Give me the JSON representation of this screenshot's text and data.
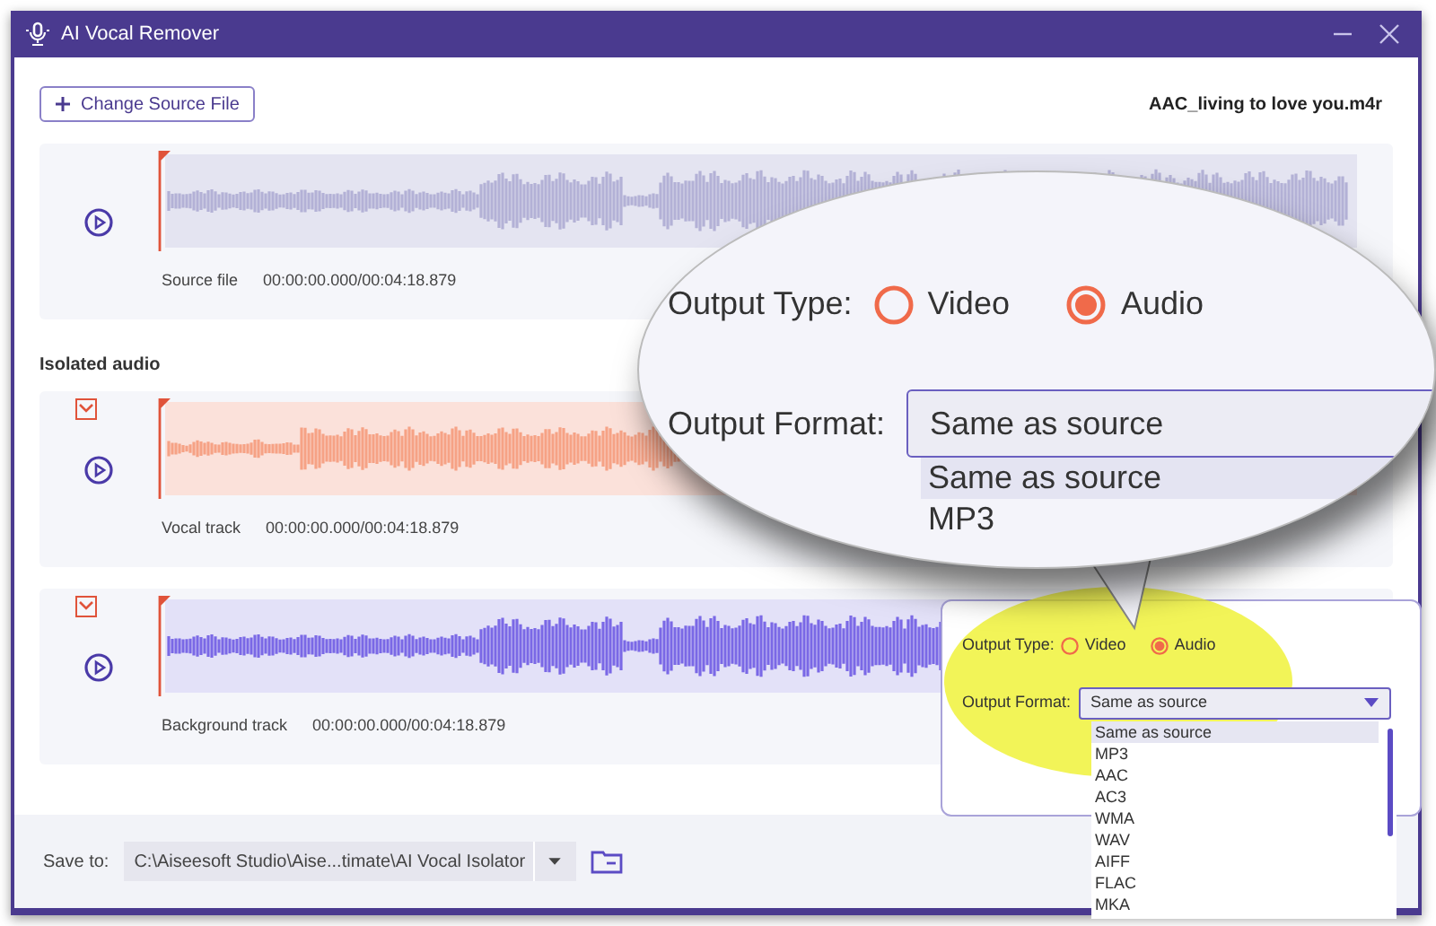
{
  "window": {
    "title": "AI Vocal Remover"
  },
  "change_source_button": {
    "label": "Change Source File"
  },
  "file_name": "AAC_living to love you.m4r",
  "source_track": {
    "kind": "source",
    "label": "Source file",
    "time": "00:00:00.000/00:04:18.879"
  },
  "section_title": "Isolated audio",
  "tracks": [
    {
      "kind": "vocal",
      "checked": true,
      "label": "Vocal track",
      "time": "00:00:00.000/00:04:18.879"
    },
    {
      "kind": "background",
      "checked": true,
      "label": "Background track",
      "time": "00:00:00.000/00:04:18.879"
    }
  ],
  "save_bar": {
    "label": "Save to:",
    "path": "C:\\Aiseesoft Studio\\Aise...timate\\AI Vocal Isolator"
  },
  "output_panel": {
    "type_label": "Output Type:",
    "type_options": [
      {
        "label": "Video",
        "selected": false
      },
      {
        "label": "Audio",
        "selected": true
      }
    ],
    "format_label": "Output Format:",
    "format_value": "Same as source",
    "format_list": [
      {
        "label": "Same as source",
        "selected": true
      },
      {
        "label": "MP3",
        "selected": false
      },
      {
        "label": "AAC",
        "selected": false
      },
      {
        "label": "AC3",
        "selected": false
      },
      {
        "label": "WMA",
        "selected": false
      },
      {
        "label": "WAV",
        "selected": false
      },
      {
        "label": "AIFF",
        "selected": false
      },
      {
        "label": "FLAC",
        "selected": false
      },
      {
        "label": "MKA",
        "selected": false
      }
    ]
  },
  "callout": {
    "type_label": "Output Type:",
    "type_options": [
      {
        "label": "Video",
        "selected": false
      },
      {
        "label": "Audio",
        "selected": true
      }
    ],
    "format_label": "Output Format:",
    "format_value": "Same as source",
    "format_list": [
      {
        "label": "Same as source",
        "selected": true
      },
      {
        "label": "MP3",
        "selected": false
      }
    ]
  }
}
